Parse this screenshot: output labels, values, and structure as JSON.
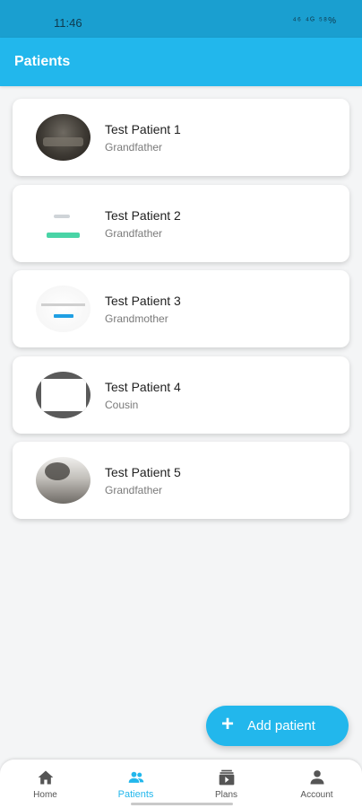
{
  "status_bar": {
    "time": "11:46",
    "icons": "⁴⁶ ⁴ᴳ ⁵⁸%"
  },
  "app_bar": {
    "title": "Patients"
  },
  "patients": [
    {
      "name": "Test Patient 1",
      "relation": "Grandfather"
    },
    {
      "name": "Test Patient 2",
      "relation": "Grandfather"
    },
    {
      "name": "Test Patient 3",
      "relation": "Grandmother"
    },
    {
      "name": "Test Patient 4",
      "relation": "Cousin"
    },
    {
      "name": "Test Patient 5",
      "relation": "Grandfather"
    }
  ],
  "fab": {
    "label": "Add patient",
    "icon": "plus-icon"
  },
  "bottom_nav": {
    "items": [
      {
        "label": "Home",
        "icon": "home-icon",
        "active": false
      },
      {
        "label": "Patients",
        "icon": "people-icon",
        "active": true
      },
      {
        "label": "Plans",
        "icon": "video-library-icon",
        "active": false
      },
      {
        "label": "Account",
        "icon": "person-icon",
        "active": false
      }
    ]
  },
  "colors": {
    "primary": "#22b7ec",
    "status_bar": "#1a9fd0",
    "background": "#f4f5f6"
  }
}
